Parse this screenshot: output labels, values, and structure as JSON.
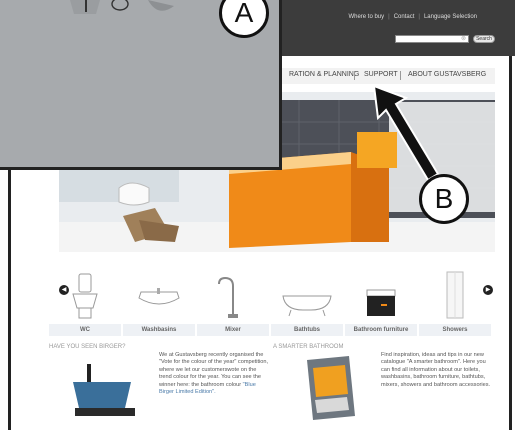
{
  "header": {
    "links": [
      "Where to buy",
      "Contact",
      "Language Selection"
    ],
    "search_placeholder": "",
    "search_button": "Search"
  },
  "nav": {
    "items": [
      "RATION & PLANNING",
      "SUPPORT",
      "ABOUT GUSTAVSBERG"
    ]
  },
  "products": [
    {
      "label": "WC"
    },
    {
      "label": "Washbasins"
    },
    {
      "label": "Mixer"
    },
    {
      "label": "Bathtubs"
    },
    {
      "label": "Bathroom furniture"
    },
    {
      "label": "Showers"
    }
  ],
  "promo_birger": {
    "title": "HAVE YOU SEEN BIRGER?",
    "text": "We at Gustavsberg recently organised the \"Vote for the colour of the year\" competition, where we let our customers vote on the trend colour for the year. You can see the winner here: the bathroom colour ",
    "link": "\"Blue Birger Limited Edition\".",
    "text_pre_link": "We at Gustavsberg recently organised the \"Vote for the colour of the year\" competition, where we let our customerswote on the trend colour for the year. You can see the winner here: the bathroom colour "
  },
  "promo_smarter": {
    "title": "A SMARTER BATHROOM",
    "text": "Find inspiration, ideas and tips in our new catalogue \"A smarter bathroom\". Here you can find all information about our toilets, washbasins, bathroom furniture, bathtubs, mixers, showers and bathroom accessories."
  },
  "callouts": {
    "a": "A",
    "b": "B"
  },
  "colors": {
    "topbar": "#3c3c3c",
    "overlay": "#a7aaad",
    "accent_orange": "#f0a020",
    "link_blue": "#4a7aa8"
  }
}
